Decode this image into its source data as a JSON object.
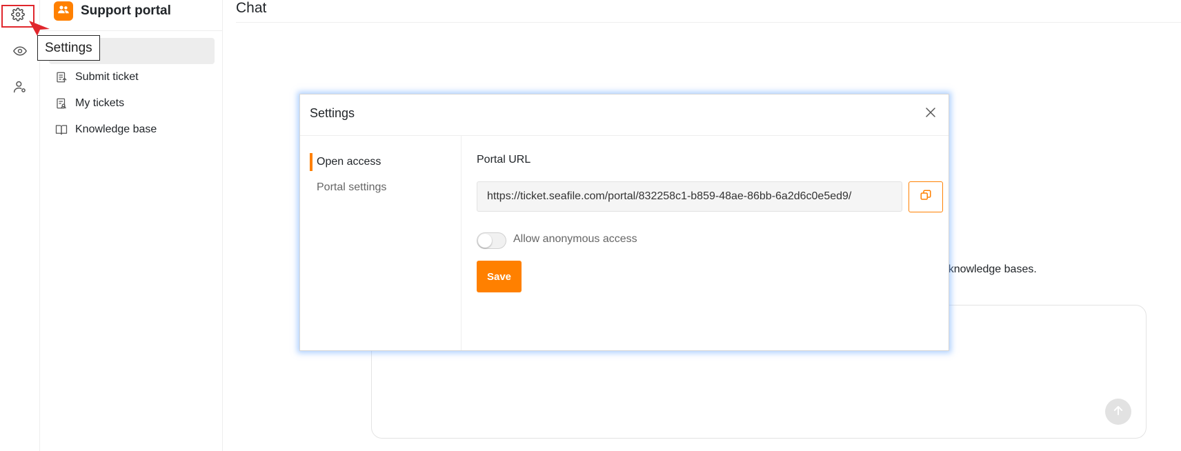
{
  "rail": {
    "items": [
      {
        "name": "settings",
        "icon": "gear-icon"
      },
      {
        "name": "preview",
        "icon": "eye-icon"
      },
      {
        "name": "users",
        "icon": "user-settings-icon"
      }
    ],
    "tooltip": "Settings",
    "highlight_color": "#e0262c"
  },
  "nav": {
    "title": "Support portal",
    "items": [
      {
        "label": "",
        "icon": "chat-icon",
        "active": true
      },
      {
        "label": "Submit ticket",
        "icon": "ticket-submit-icon"
      },
      {
        "label": "My tickets",
        "icon": "ticket-list-icon"
      },
      {
        "label": "Knowledge base",
        "icon": "book-icon"
      }
    ]
  },
  "main": {
    "title": "Chat",
    "hint_fragment": "hing knowledge bases."
  },
  "modal": {
    "title": "Settings",
    "menu": [
      {
        "label": "Open access",
        "active": true
      },
      {
        "label": "Portal settings",
        "active": false
      }
    ],
    "url_label": "Portal URL",
    "url_value": "https://ticket.seafile.com/portal/832258c1-b859-48ae-86bb-6a2d6c0e5ed9/",
    "toggle_label": "Allow anonymous access",
    "toggle_on": false,
    "save_label": "Save"
  },
  "colors": {
    "accent": "#ff8000",
    "border": "#eeeeee",
    "modal_glow": "#6eaaff"
  }
}
